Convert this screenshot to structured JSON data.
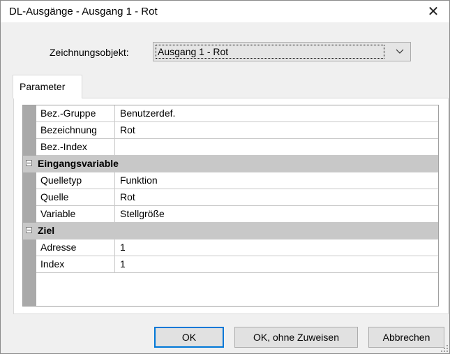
{
  "window": {
    "title": "DL-Ausgänge - Ausgang 1 - Rot",
    "close_glyph": "✕"
  },
  "drawing_object": {
    "label": "Zeichnungsobjekt:",
    "selected": "Ausgang 1 - Rot"
  },
  "tabs": [
    {
      "label": "Parameter"
    }
  ],
  "properties": {
    "general": [
      {
        "name": "Bez.-Gruppe",
        "value": "Benutzerdef."
      },
      {
        "name": "Bezeichnung",
        "value": "Rot"
      },
      {
        "name": "Bez.-Index",
        "value": ""
      }
    ],
    "input_category": "Eingangsvariable",
    "input": [
      {
        "name": "Quelletyp",
        "value": "Funktion"
      },
      {
        "name": "Quelle",
        "value": "Rot"
      },
      {
        "name": "Variable",
        "value": "Stellgröße"
      }
    ],
    "target_category": "Ziel",
    "target": [
      {
        "name": "Adresse",
        "value": "1"
      },
      {
        "name": "Index",
        "value": "1"
      }
    ]
  },
  "buttons": {
    "ok": "OK",
    "ok_no_assign": "OK, ohne Zuweisen",
    "cancel": "Abbrechen"
  },
  "icons": [
    "close-icon",
    "chevron-down-icon",
    "collapse-icon",
    "resize-grip-icon"
  ]
}
